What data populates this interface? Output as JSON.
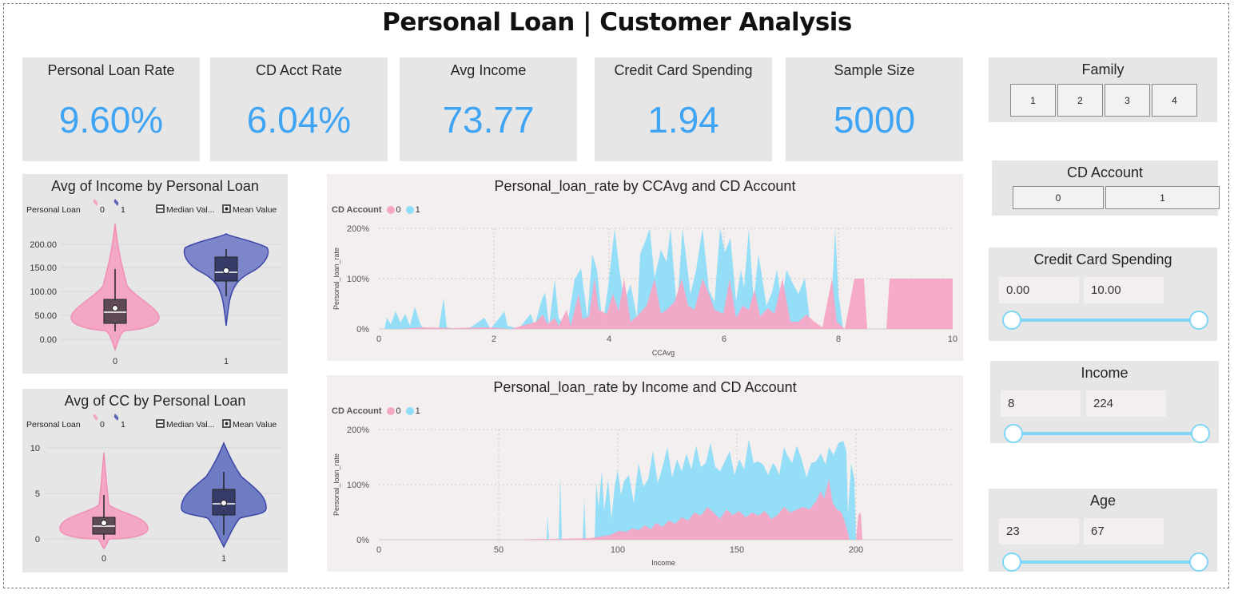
{
  "page": {
    "title": "Personal Loan | Customer Analysis"
  },
  "kpis": [
    {
      "label": "Personal Loan Rate",
      "value": "9.60%"
    },
    {
      "label": "CD Acct Rate",
      "value": "6.04%"
    },
    {
      "label": "Avg Income",
      "value": "73.77"
    },
    {
      "label": "Credit Card Spending",
      "value": "1.94"
    },
    {
      "label": "Sample Size",
      "value": "5000"
    }
  ],
  "filters": {
    "family": {
      "title": "Family",
      "options": [
        "1",
        "2",
        "3",
        "4"
      ]
    },
    "cd_account": {
      "title": "CD Account",
      "options": [
        "0",
        "1"
      ]
    },
    "credit_card_spending": {
      "title": "Credit Card Spending",
      "min": "0.00",
      "max": "10.00"
    },
    "income": {
      "title": "Income",
      "min": "8",
      "max": "224"
    },
    "age": {
      "title": "Age",
      "min": "23",
      "max": "67"
    }
  },
  "colors": {
    "accent": "#3ea4f3",
    "pink": "#f4a7c5",
    "cyan": "#8fdcf7",
    "violin_blue": "#6f7cc4",
    "slider": "#7fd6f7"
  },
  "violins": {
    "income": {
      "title": "Avg of Income by Personal Loan",
      "legend_title": "Personal Loan",
      "legend_series": [
        "0",
        "1"
      ],
      "legend_median": "Median Val...",
      "legend_mean": "Mean Value",
      "y_ticks": [
        "200.00",
        "150.00",
        "100.00",
        "50.00",
        "0.00"
      ],
      "x_labels": [
        "0",
        "1"
      ]
    },
    "cc": {
      "title": "Avg of CC by Personal Loan",
      "legend_title": "Personal Loan",
      "legend_series": [
        "0",
        "1"
      ],
      "legend_median": "Median Val...",
      "legend_mean": "Mean Value",
      "y_ticks": [
        "10",
        "5",
        "0"
      ],
      "x_labels": [
        "0",
        "1"
      ]
    }
  },
  "chart_data": [
    {
      "type": "area",
      "title": "Personal_loan_rate by CCAvg and CD Account",
      "legend_title": "CD Account",
      "series": [
        {
          "name": "0"
        },
        {
          "name": "1"
        }
      ],
      "xlabel": "CCAvg",
      "ylabel": "Personal_loan_rate",
      "xlim": [
        0,
        10
      ],
      "ylim": [
        0,
        2
      ],
      "x_ticks": [
        "0",
        "2",
        "4",
        "6",
        "8",
        "10"
      ],
      "y_ticks": [
        "200%",
        "100%",
        "0%"
      ],
      "grid": true
    },
    {
      "type": "area",
      "title": "Personal_loan_rate by Income and CD Account",
      "legend_title": "CD Account",
      "series": [
        {
          "name": "0"
        },
        {
          "name": "1"
        }
      ],
      "xlabel": "Income",
      "ylabel": "Personal_loan_rate",
      "xlim": [
        0,
        224
      ],
      "ylim": [
        0,
        2
      ],
      "x_ticks": [
        "0",
        "50",
        "100",
        "150",
        "200"
      ],
      "y_ticks": [
        "200%",
        "100%",
        "0%"
      ],
      "grid": true
    }
  ]
}
